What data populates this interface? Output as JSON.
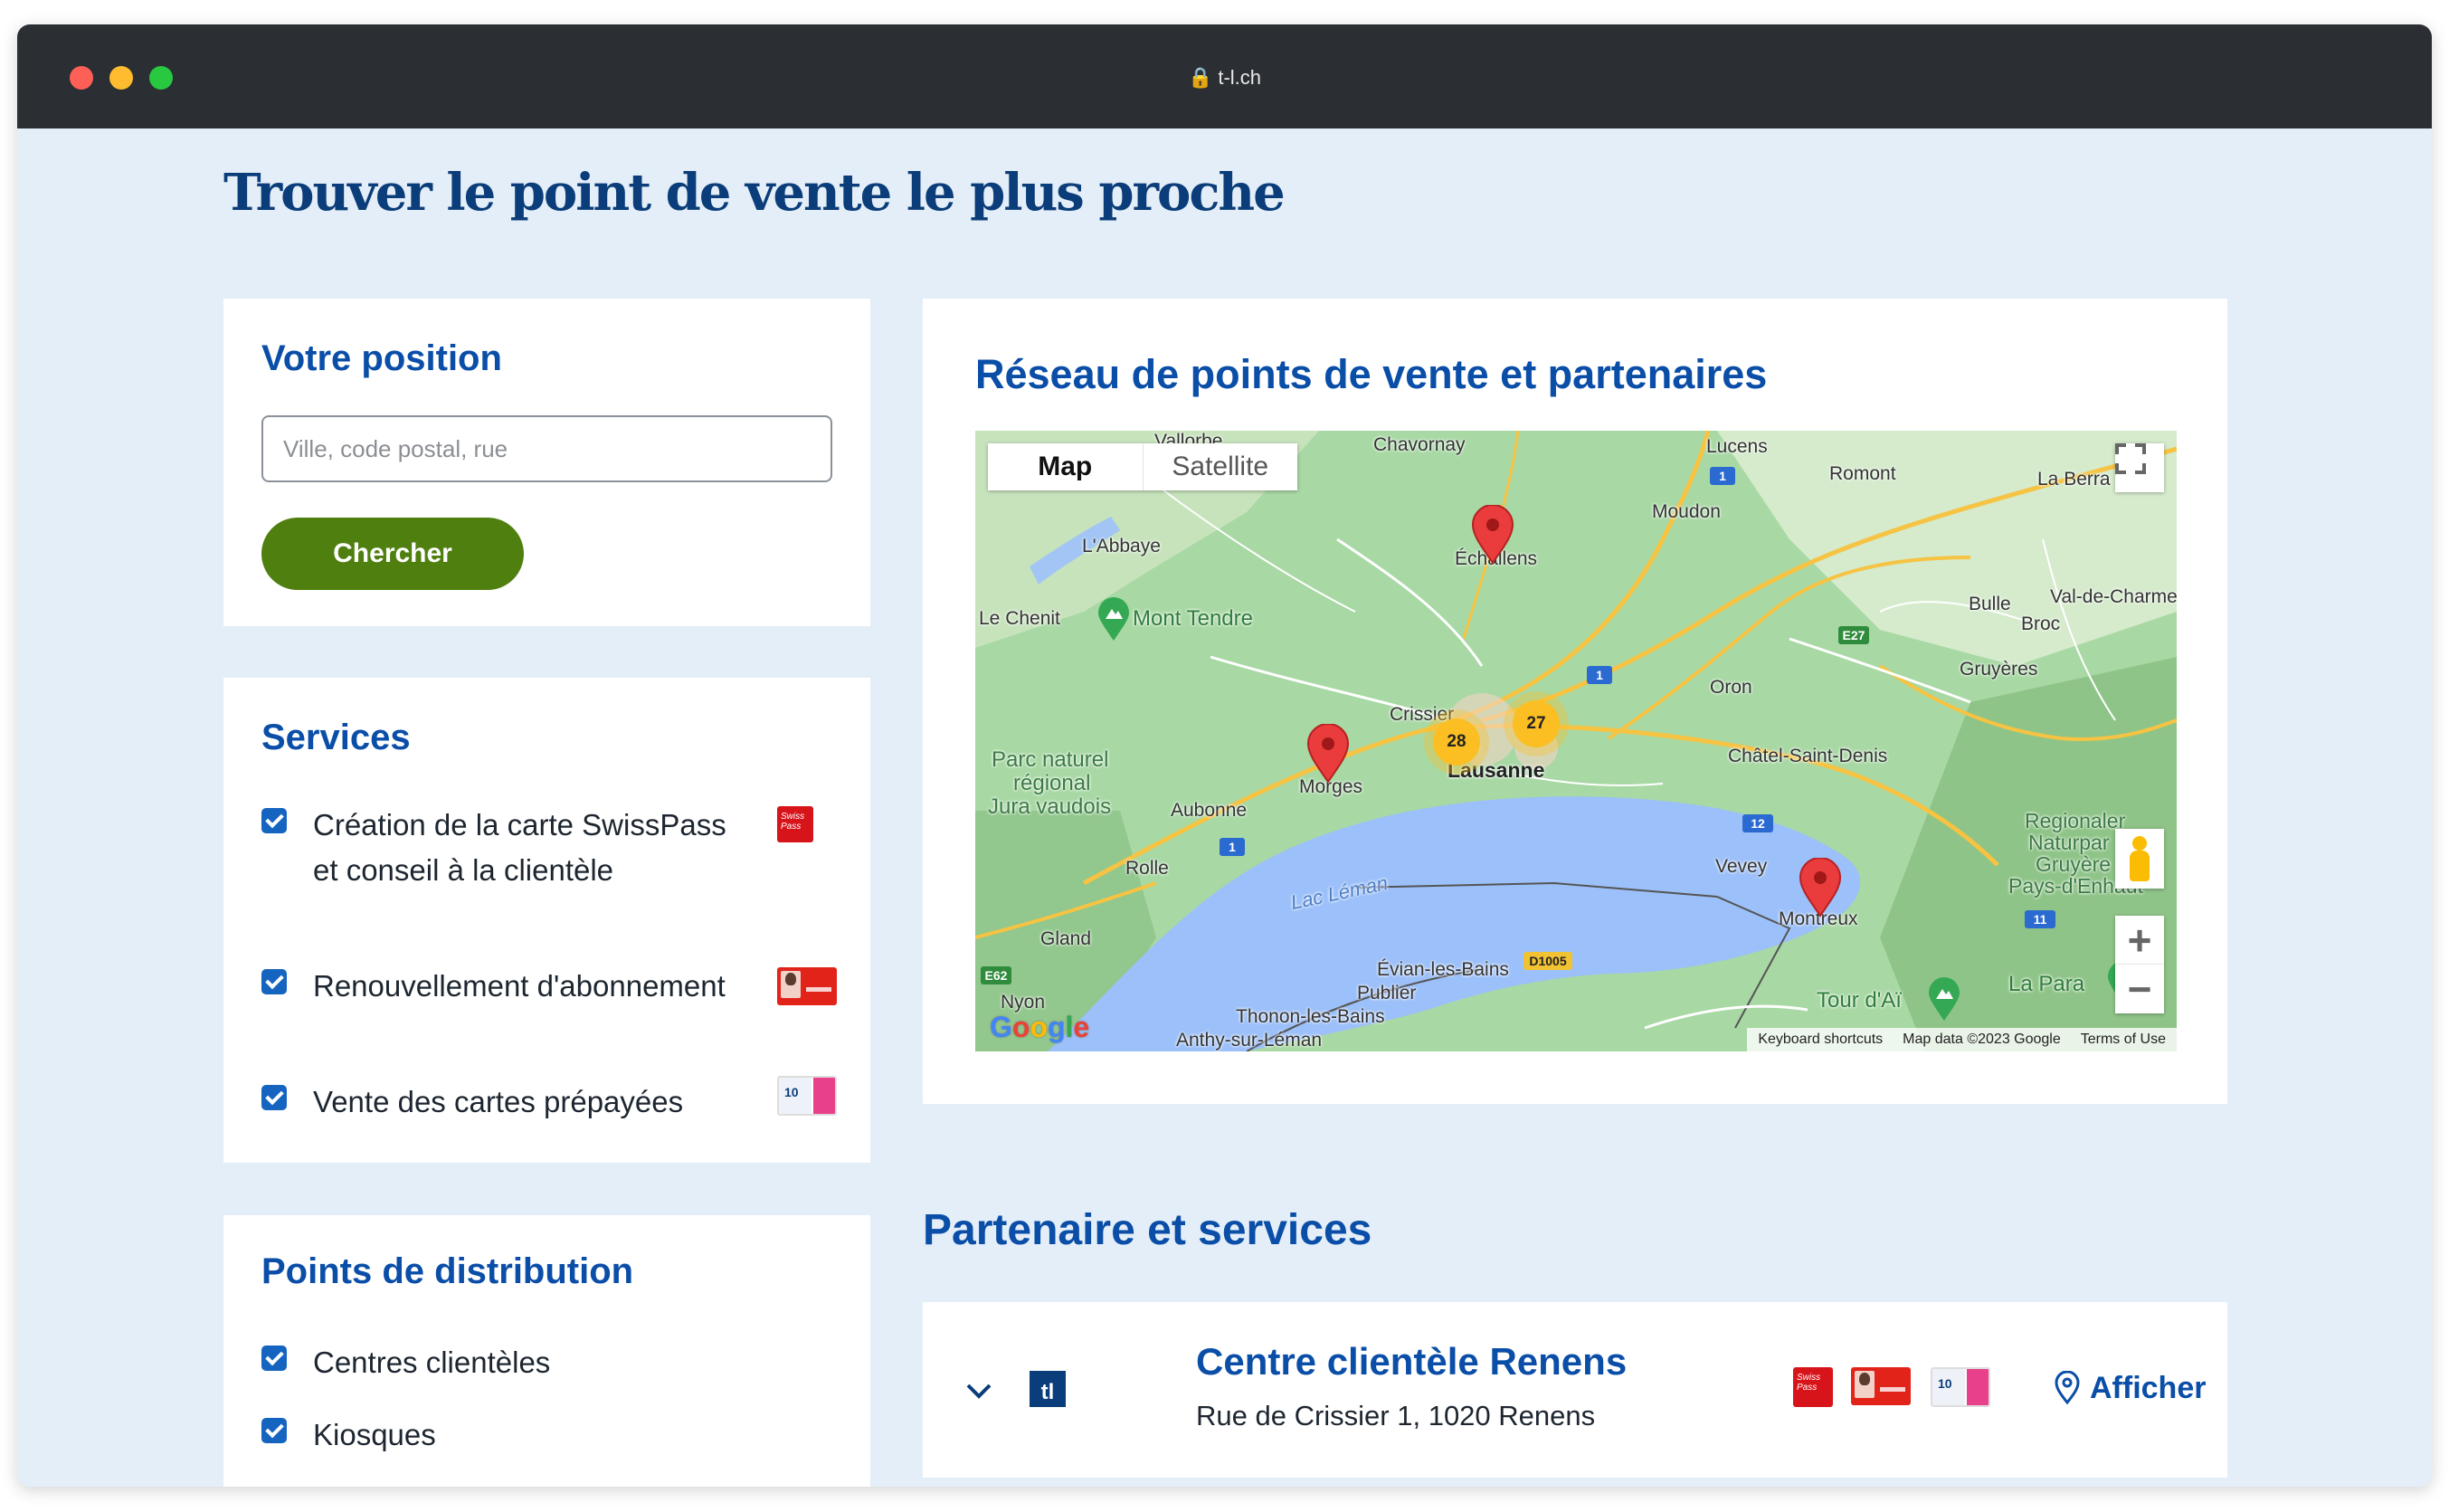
{
  "browser": {
    "url": "t-l.ch"
  },
  "page": {
    "title": "Trouver le point de vente le plus proche"
  },
  "position": {
    "heading": "Votre position",
    "input_placeholder": "Ville, code postal, rue",
    "input_value": "",
    "search_button": "Chercher"
  },
  "services": {
    "heading": "Services",
    "items": [
      {
        "label": "Création de la carte SwissPass et conseil à la clientèle",
        "checked": true,
        "icon": "swisspass-card-icon"
      },
      {
        "label": "Renouvellement d'abonnement",
        "checked": true,
        "icon": "subscription-card-icon"
      },
      {
        "label": "Vente des cartes prépayées",
        "checked": true,
        "icon": "prepaid-card-icon"
      }
    ],
    "swisspass_icon_text": "Swiss Pass"
  },
  "distribution": {
    "heading": "Points de distribution",
    "items": [
      {
        "label": "Centres clientèles",
        "checked": true
      },
      {
        "label": "Kiosques",
        "checked": true
      }
    ]
  },
  "map": {
    "heading": "Réseau de points de vente et partenaires",
    "type_options": [
      "Map",
      "Satellite"
    ],
    "selected_type": "Map",
    "zoom_in": "+",
    "zoom_out": "−",
    "clusters": [
      "28",
      "27"
    ],
    "places": {
      "vallorbe": "Vallorbe",
      "chavornay": "Chavornay",
      "lucens": "Lucens",
      "romont": "Romont",
      "la_berra": "La Berra",
      "labbaye": "L'Abbaye",
      "moudon": "Moudon",
      "echallens": "Échallens",
      "le_chenit": "Le Chenit",
      "mont_tendre": "Mont Tendre",
      "bulle": "Bulle",
      "val_de_charme": "Val-de-Charme",
      "broc": "Broc",
      "gruyeres": "Gruyères",
      "oron": "Oron",
      "crissier": "Crissier",
      "renens": "ens",
      "lausanne": "Lausanne",
      "parc": "Parc naturel",
      "parc2": "régional",
      "parc3": "Jura vaudois",
      "chatel": "Châtel-Saint-Denis",
      "aubonne": "Aubonne",
      "morges": "Morges",
      "regional": "Regionaler",
      "naturpark": "Naturpar",
      "gruyere": "Gruyère",
      "pays": "Pays-d'Enhaut",
      "rolle": "Rolle",
      "vevey": "Vevey",
      "lac": "Lac Léman",
      "montreux": "Montreux",
      "gland": "Gland",
      "evian": "Évian-les-Bains",
      "publier": "Publier",
      "tour": "Tour d'Aï",
      "la_para": "La Para",
      "nyon": "Nyon",
      "thonon": "Thonon-les-Bains",
      "anthy": "Anthy-sur-Léman"
    },
    "shields": {
      "a1": "1",
      "a2": "1",
      "e27": "E27",
      "a3": "1",
      "a12": "12",
      "a4": "1",
      "a11": "11",
      "e62": "E62",
      "d1005": "D1005"
    },
    "attribution": [
      "Keyboard shortcuts",
      "Map data ©2023 Google",
      "Terms of Use"
    ],
    "google_letters": [
      "G",
      "o",
      "o",
      "g",
      "l",
      "e"
    ]
  },
  "partners": {
    "heading": "Partenaire et services",
    "items": [
      {
        "name": "Centre clientèle Renens",
        "address": "Rue de Crissier 1, 1020 Renens",
        "logo": "tl",
        "action": "Afficher"
      }
    ]
  },
  "colors": {
    "brand_blue": "#0a4ea8",
    "title_blue": "#0a3d79",
    "button_green": "#4f7f0f",
    "checkbox_blue": "#1565c0",
    "page_bg": "#e4eef8"
  }
}
